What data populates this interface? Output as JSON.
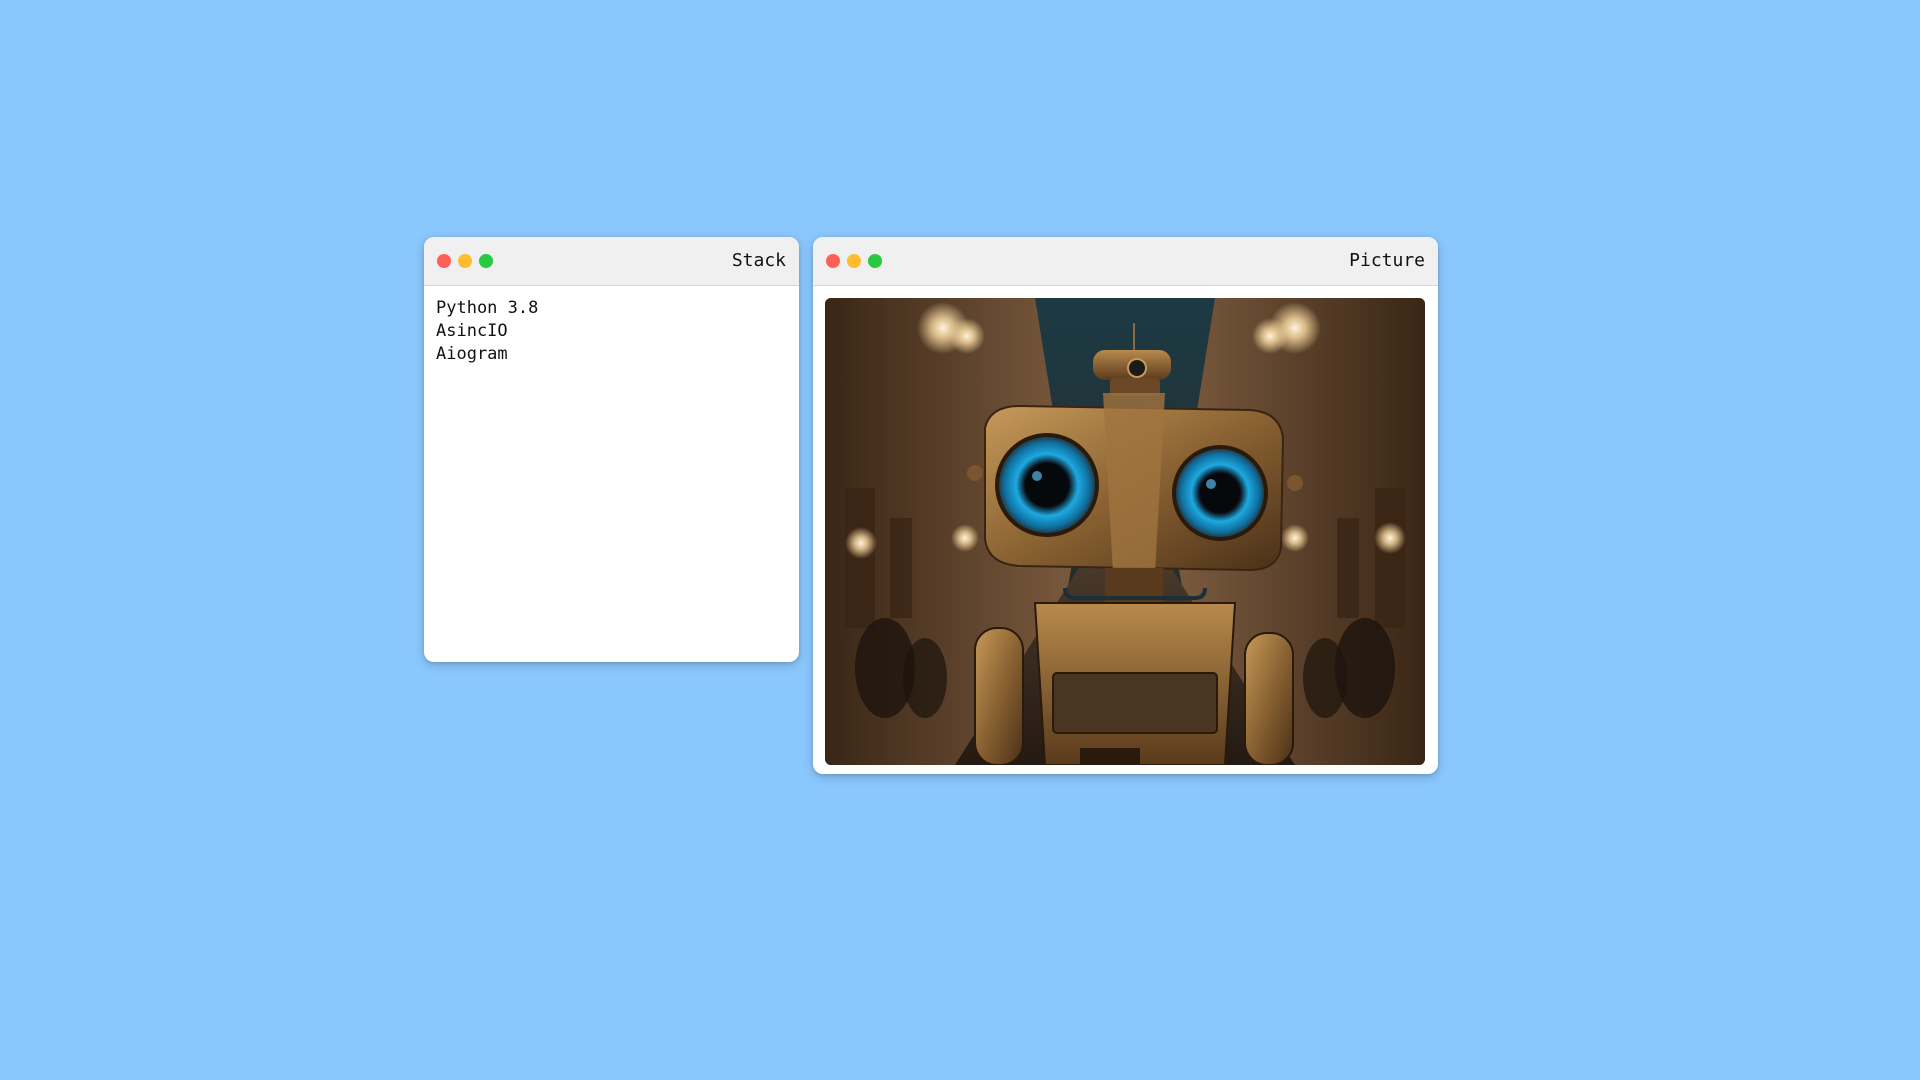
{
  "theme": {
    "desktop_bg": "#8AC7FD",
    "dot_close": "#FF5F57",
    "dot_min": "#FEBC2E",
    "dot_max": "#28C840"
  },
  "windows": {
    "stack": {
      "title": "Stack",
      "lines": [
        "Python 3.8",
        "AsincIO",
        "Aiogram"
      ]
    },
    "picture": {
      "title": "Picture",
      "image_subject": "robot-photo"
    }
  }
}
